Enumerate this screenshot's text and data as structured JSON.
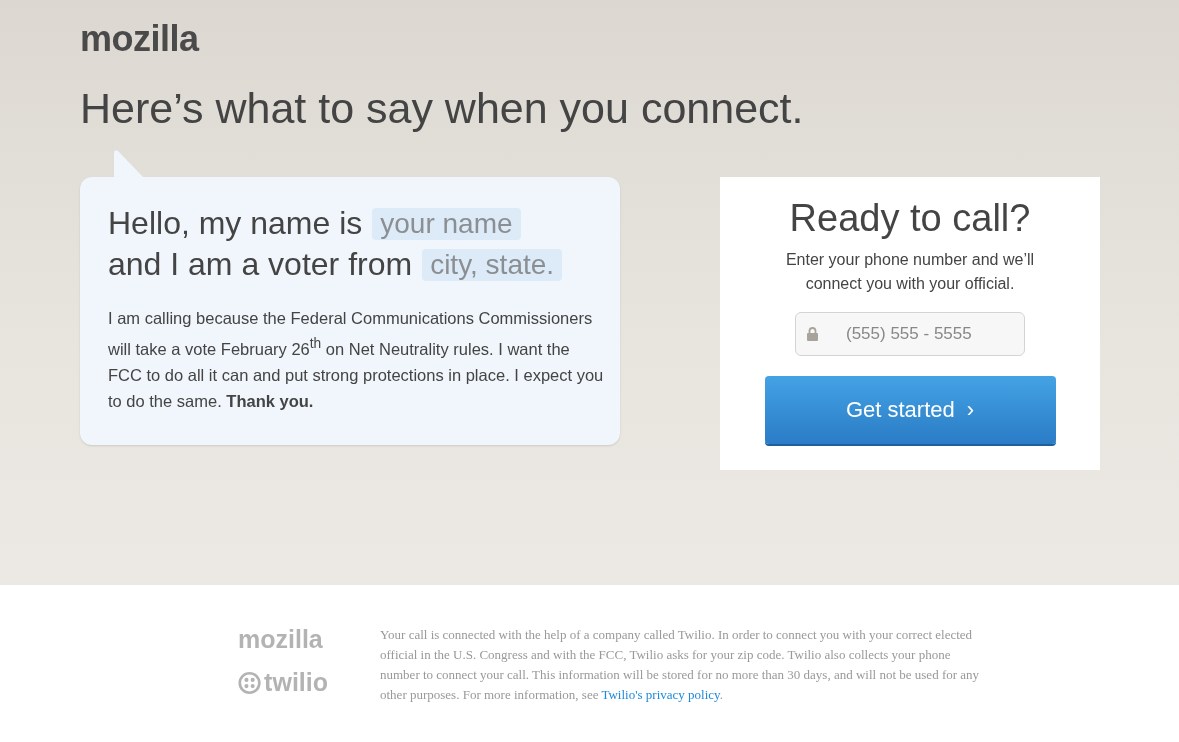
{
  "header": {
    "logo": "mozilla",
    "title": "Here’s what to say when you connect."
  },
  "script": {
    "lines": [
      {
        "text": "Hello, my name is",
        "blank": "your name"
      },
      {
        "text": "and I am a voter from",
        "blank": "city, state."
      }
    ],
    "body": "I am calling because the Federal Communications Commissioners will take a vote February 26$^{th}$ on Net Neutrality rules. I want the FCC to do all it can and put strong protections in place. I expect you to do the same. **Thank you.**"
  },
  "call_card": {
    "title": "Ready to call?",
    "subtitle": "Enter your phone number and we’ll connect you with your official.",
    "phone_field": {
      "placeholder": "(555) 555 - 5555"
    },
    "button": {
      "label": "Get started",
      "arrow": "›"
    }
  },
  "footer": {
    "logos": [
      "mozilla",
      "twilio"
    ],
    "text": "Your call is connected with the help of a company called Twilio. In order to connect you with your correct elected official in the U.S. Congress and with the FCC, Twilio asks for your zip code. Twilio also collects your phone number to connect your call. This information will be stored for no more than 30 days, and will not be used for any other purposes. For more information, see",
    "link": "Twilio's privacy policy",
    "end": "."
  }
}
